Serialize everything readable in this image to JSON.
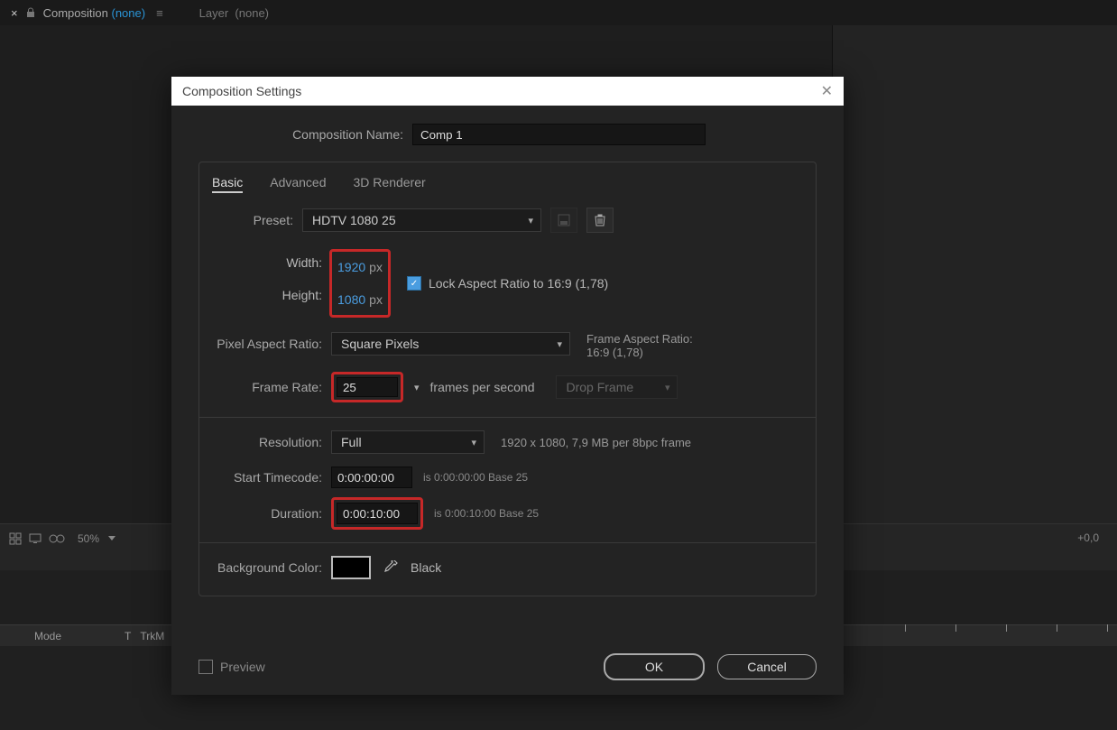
{
  "topbar": {
    "close": "×",
    "composition_label": "Composition",
    "composition_none": "(none)",
    "menu_icon": "≡",
    "layer_label": "Layer",
    "layer_none": "(none)"
  },
  "viewer_footer": {
    "zoom_pct": "50%",
    "offset": "+0,0"
  },
  "timeline": {
    "mode": "Mode",
    "t": "T",
    "trkm": "TrkM"
  },
  "dialog": {
    "title": "Composition Settings",
    "name_label": "Composition Name:",
    "name_value": "Comp 1",
    "tabs": [
      "Basic",
      "Advanced",
      "3D Renderer"
    ],
    "preset_label": "Preset:",
    "preset_value": "HDTV 1080 25",
    "width_label": "Width:",
    "width_value": "1920",
    "height_label": "Height:",
    "height_value": "1080",
    "px": "px",
    "lock_aspect": "Lock Aspect Ratio to 16:9 (1,78)",
    "par_label": "Pixel Aspect Ratio:",
    "par_value": "Square Pixels",
    "far_label": "Frame Aspect Ratio:",
    "far_value": "16:9 (1,78)",
    "fr_label": "Frame Rate:",
    "fr_value": "25",
    "fps": "frames per second",
    "drop_frame": "Drop Frame",
    "res_label": "Resolution:",
    "res_value": "Full",
    "res_info": "1920 x 1080, 7,9 MB per 8bpc frame",
    "stc_label": "Start Timecode:",
    "stc_value": "0:00:00:00",
    "stc_info": "is 0:00:00:00  Base 25",
    "dur_label": "Duration:",
    "dur_value": "0:00:10:00",
    "dur_info": "is 0:00:10:00  Base 25",
    "bg_label": "Background Color:",
    "bg_name": "Black",
    "preview": "Preview",
    "ok": "OK",
    "cancel": "Cancel"
  }
}
